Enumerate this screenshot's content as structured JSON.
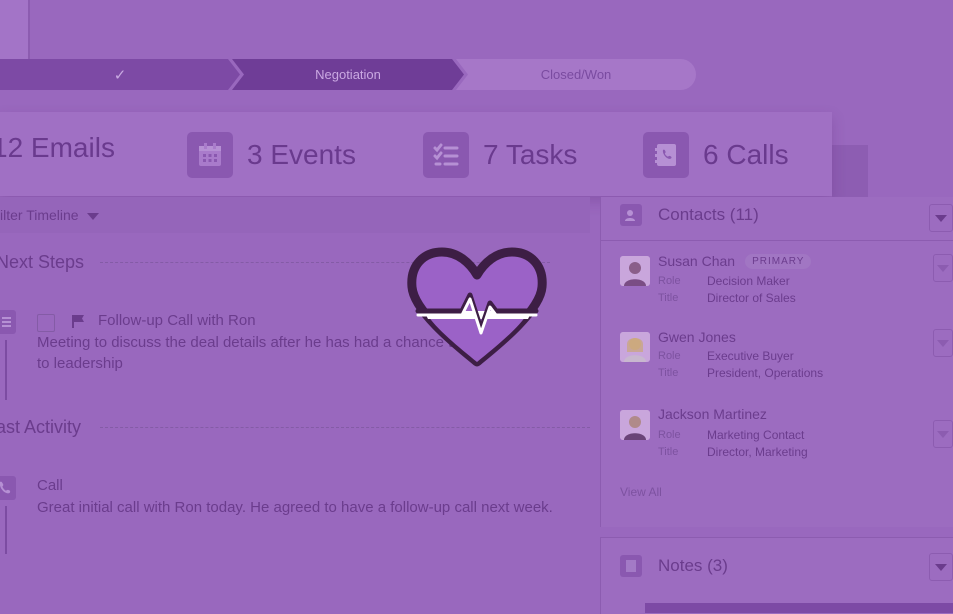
{
  "path": {
    "steps": [
      {
        "label": "✓",
        "state": "complete"
      },
      {
        "label": "Negotiation",
        "state": "current"
      },
      {
        "label": "Closed/Won",
        "state": "upcoming"
      }
    ]
  },
  "stats": [
    {
      "label": "12 Emails",
      "icon": "email-icon"
    },
    {
      "label": "3 Events",
      "icon": "calendar-icon"
    },
    {
      "label": "7 Tasks",
      "icon": "task-list-icon"
    },
    {
      "label": "6 Calls",
      "icon": "phone-book-icon"
    }
  ],
  "timeline": {
    "filter_label": "ilter Timeline",
    "next_steps_title": "Next Steps",
    "task": {
      "title": "Follow-up Call with Ron",
      "description_line1": "Meeting to discuss the deal details after he has had a chance to talk",
      "description_line2": "to leadership"
    },
    "past_activity_title": "ast Activity",
    "call": {
      "title": "Call",
      "description": "Great initial call with Ron today. He agreed to have a follow-up call next week."
    }
  },
  "contacts": {
    "header": "Contacts (11)",
    "role_label": "Role",
    "title_label": "Title",
    "items": [
      {
        "name": "Susan Chan",
        "badge": "PRIMARY",
        "role": "Decision Maker",
        "title": "Director of Sales"
      },
      {
        "name": "Gwen Jones",
        "badge": "",
        "role": "Executive Buyer",
        "title": "President, Operations"
      },
      {
        "name": "Jackson Martinez",
        "badge": "",
        "role": "Marketing Contact",
        "title": "Director, Marketing"
      }
    ],
    "view_all": "View All"
  },
  "notes": {
    "header": "Notes (3)"
  },
  "colors": {
    "overlay": "#9968be",
    "heart_outline": "#3d1e45",
    "heart_fill": "#9b62c7"
  }
}
